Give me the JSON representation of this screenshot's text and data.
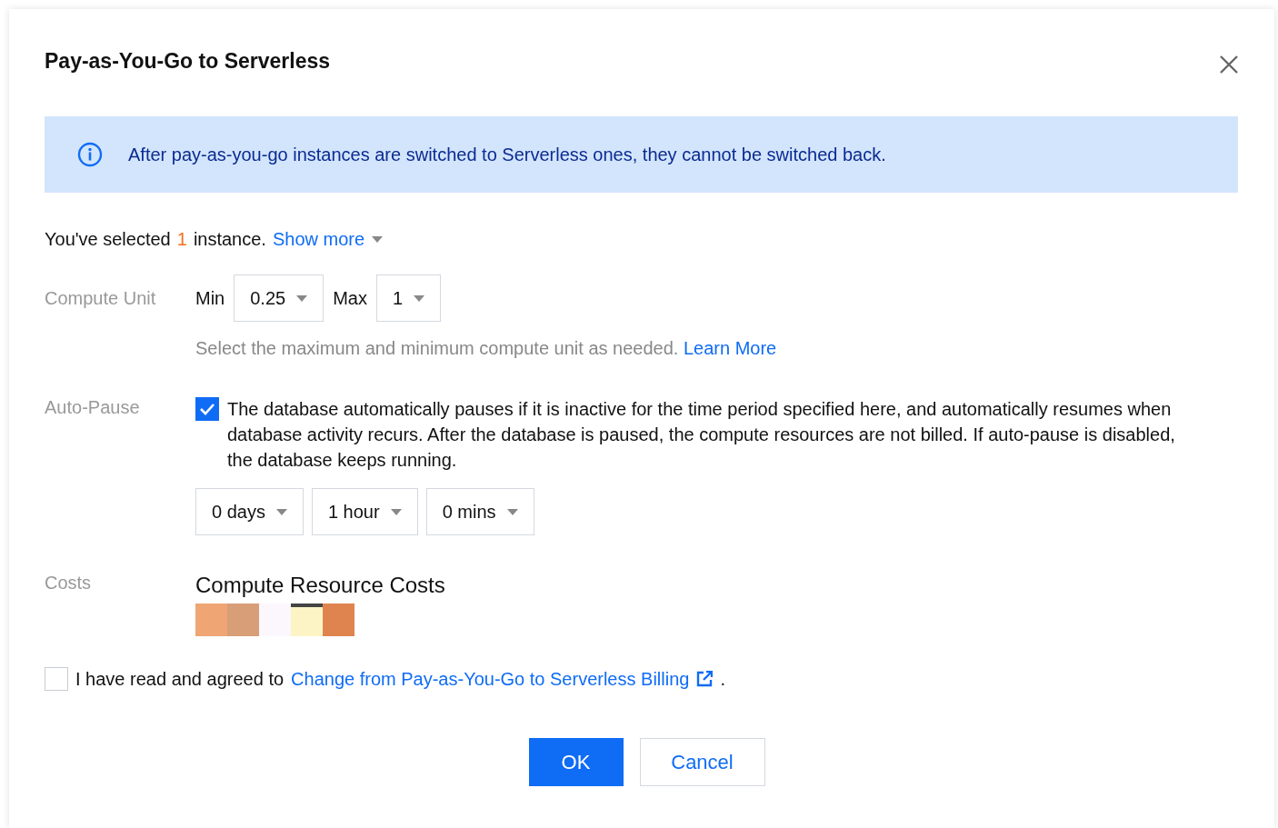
{
  "dialog": {
    "title": "Pay-as-You-Go to Serverless"
  },
  "notice": {
    "text": "After pay-as-you-go instances are switched to Serverless ones, they cannot be switched back."
  },
  "selection": {
    "prefix": "You've selected",
    "count": "1",
    "suffix": "instance.",
    "link": "Show more"
  },
  "compute_unit": {
    "label": "Compute Unit",
    "min_label": "Min",
    "min_value": "0.25",
    "max_label": "Max",
    "max_value": "1",
    "hint": "Select the maximum and minimum compute unit as needed.",
    "hint_link": "Learn More"
  },
  "auto_pause": {
    "label": "Auto-Pause",
    "checked": true,
    "description": "The database automatically pauses if it is inactive for the time period specified here, and automatically resumes when database activity recurs. After the database is paused, the compute resources are not billed. If auto-pause is disabled, the database keeps running.",
    "durations": [
      "0 days",
      "1 hour",
      "0 mins"
    ]
  },
  "costs": {
    "label": "Costs",
    "heading": "Compute Resource Costs"
  },
  "agreement": {
    "checked": false,
    "text": "I have read and agreed to",
    "link": "Change from Pay-as-You-Go to Serverless Billing",
    "end": "."
  },
  "buttons": [
    {
      "label": "OK",
      "kind": "primary"
    },
    {
      "label": "Cancel",
      "kind": "secondary"
    }
  ]
}
